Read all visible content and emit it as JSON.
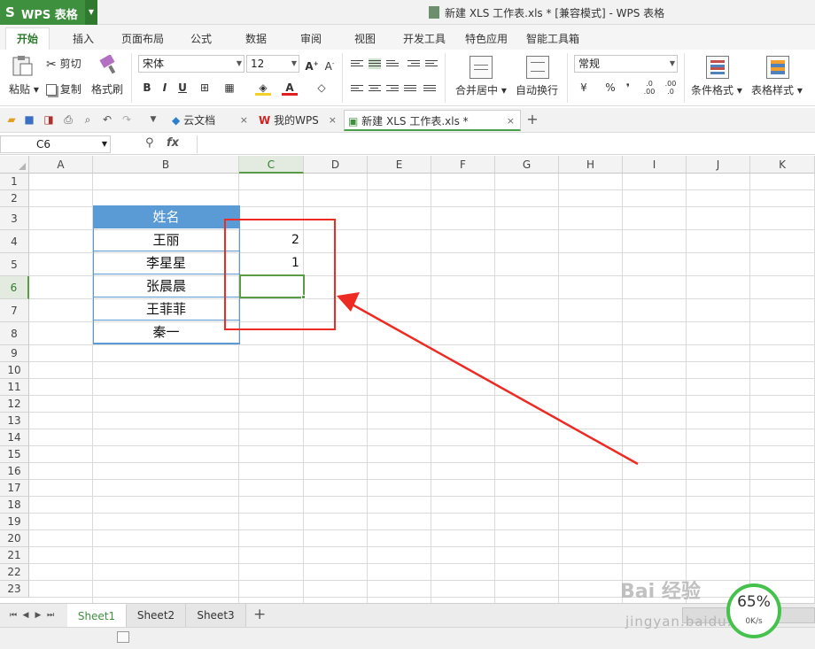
{
  "app": {
    "name": "WPS 表格",
    "window_title": "新建 XLS 工作表.xls * [兼容模式] - WPS 表格"
  },
  "ribbon_tabs": [
    "开始",
    "插入",
    "页面布局",
    "公式",
    "数据",
    "审阅",
    "视图",
    "开发工具",
    "特色应用",
    "智能工具箱"
  ],
  "ribbon": {
    "paste": "粘贴",
    "cut": "剪切",
    "copy": "复制",
    "format_painter": "格式刷",
    "font_name": "宋体",
    "font_size": "12",
    "bold": "B",
    "italic": "I",
    "underline": "U",
    "merge_center": "合并居中",
    "wrap_text": "自动换行",
    "number_format": "常规",
    "percent": "%",
    "comma": "❜",
    "conditional_format": "条件格式",
    "table_style": "表格样式"
  },
  "doc_tabs": [
    {
      "label": "云文档"
    },
    {
      "label": "我的WPS"
    },
    {
      "label": "新建 XLS 工作表.xls *"
    }
  ],
  "formula_bar": {
    "name_box": "C6",
    "fx": "fx",
    "formula": ""
  },
  "columns": [
    "A",
    "B",
    "C",
    "D",
    "E",
    "F",
    "G",
    "H",
    "I",
    "J",
    "K"
  ],
  "rows": [
    "1",
    "2",
    "3",
    "4",
    "5",
    "6",
    "7",
    "8",
    "9",
    "10",
    "11",
    "12",
    "13",
    "14",
    "15",
    "16",
    "17",
    "18",
    "19",
    "20",
    "21",
    "22",
    "23"
  ],
  "selected": {
    "column": "C",
    "row": "6"
  },
  "table": {
    "header": "姓名",
    "names": [
      "王丽",
      "李星星",
      "张晨晨",
      "王菲菲",
      "秦一"
    ],
    "values": [
      "2",
      "1",
      "",
      "",
      ""
    ]
  },
  "sheet_tabs": [
    "Sheet1",
    "Sheet2",
    "Sheet3"
  ],
  "active_sheet": "Sheet1",
  "overlay": {
    "watermark": "Bai 经验",
    "watermark_url": "jingyan.baidu.com",
    "speed_percent": "65%",
    "speed_rate": "0K/s"
  },
  "colors": {
    "accent_green": "#3e8f3e",
    "header_fill": "#5b9bd5",
    "annotation_red": "#ee2b22",
    "selection_border": "#5a9b46"
  }
}
